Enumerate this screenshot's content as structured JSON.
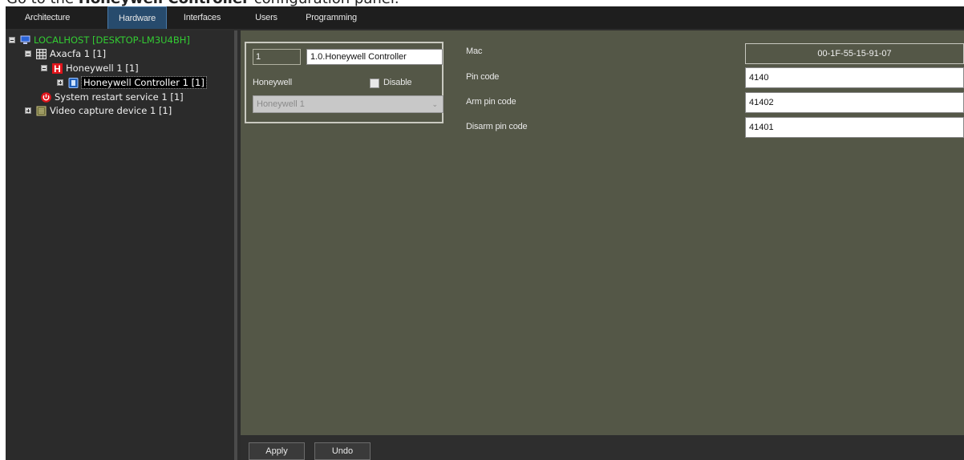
{
  "caption": {
    "prefix": "Go to the ",
    "bold": "Honeywell Controller",
    "suffix": " configuration panel."
  },
  "menu": {
    "tabs": [
      {
        "label": "Architecture"
      },
      {
        "label": "Hardware",
        "active": true
      },
      {
        "label": "Interfaces"
      },
      {
        "label": "Users"
      },
      {
        "label": "Programming"
      }
    ]
  },
  "tree": {
    "items": [
      {
        "label": "LOCALHOST [DESKTOP-LM3U4BH]",
        "icon": "computer-icon"
      },
      {
        "label": "Axacfa 1 [1]",
        "icon": "grid-board-icon"
      },
      {
        "label": "Honeywell 1 [1]",
        "icon": "honeywell-h-icon"
      },
      {
        "label": "Honeywell Controller 1 [1]",
        "icon": "controller-icon"
      },
      {
        "label": "System restart service 1 [1]",
        "icon": "power-icon"
      },
      {
        "label": "Video capture device 1 [1]",
        "icon": "capture-card-icon"
      }
    ]
  },
  "device": {
    "id": "1",
    "name": "1.0.Honeywell Controller",
    "type_label": "Honeywell",
    "disable_label": "Disable",
    "disabled": false,
    "parent": "Honeywell 1"
  },
  "settings": {
    "mac_label": "Mac",
    "mac_value": "00-1F-55-15-91-07",
    "pin_label": "Pin code",
    "pin_value": "4140",
    "arm_label": "Arm pin code",
    "arm_value": "41402",
    "disarm_label": "Disarm pin code",
    "disarm_value": "41401"
  },
  "footer": {
    "apply_label": "Apply",
    "undo_label": "Undo"
  },
  "colors": {
    "panel": "#545747",
    "tree_bg": "#2b2b2b",
    "active_tab": "#274b6d",
    "root_text": "#33cc33",
    "honeywell_red": "#e0141b"
  }
}
